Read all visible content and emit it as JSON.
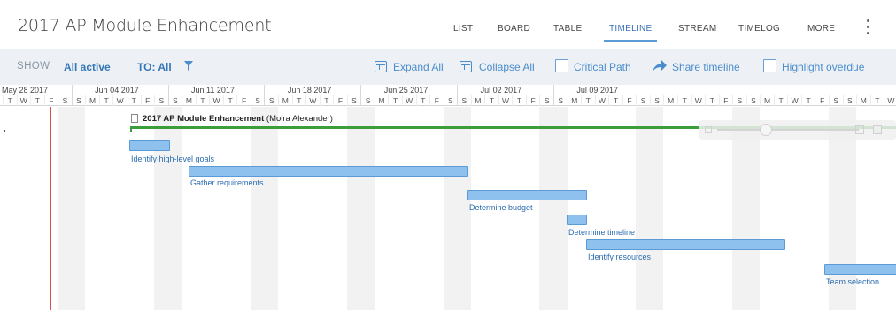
{
  "header": {
    "title": "2017 AP Module Enhancement",
    "nav": [
      "LIST",
      "BOARD",
      "TABLE",
      "TIMELINE",
      "STREAM",
      "TIMELOG",
      "MORE"
    ],
    "active_nav": "TIMELINE"
  },
  "toolbar": {
    "show_label": "SHOW",
    "show_value": "All active",
    "to_value": "TO: All",
    "expand_all": "Expand All",
    "collapse_all": "Collapse All",
    "critical_path": "Critical Path",
    "share_timeline": "Share timeline",
    "highlight_overdue": "Highlight overdue"
  },
  "timeline": {
    "weeks": [
      "May 28 2017",
      "Jun 04 2017",
      "Jun 11 2017",
      "Jun 18 2017",
      "Jun 25 2017",
      "Jul 02 2017",
      "Jul 09 2017"
    ],
    "days": [
      "T",
      "W",
      "T",
      "F",
      "S",
      "S",
      "M",
      "T",
      "W",
      "T",
      "F",
      "S",
      "S",
      "M",
      "T",
      "W",
      "T",
      "F",
      "S",
      "S",
      "M",
      "T",
      "W",
      "T",
      "F",
      "S",
      "S",
      "M",
      "T",
      "W",
      "T",
      "F",
      "S",
      "S",
      "M",
      "T",
      "W",
      "T",
      "F",
      "S",
      "S",
      "M",
      "T",
      "W",
      "T",
      "F",
      "S",
      "S",
      "M",
      "T",
      "W",
      "T",
      "F",
      "S",
      "S",
      "M",
      "T",
      "W",
      "T",
      "F",
      "S",
      "S",
      "M",
      "T",
      "W",
      "T"
    ],
    "project": {
      "name": "2017 AP Module Enhancement",
      "owner": "(Moira Alexander)"
    },
    "tasks": [
      {
        "label": "Identify high-level goals"
      },
      {
        "label": "Gather requirements"
      },
      {
        "label": "Determine budget"
      },
      {
        "label": "Determine timeline"
      },
      {
        "label": "Identify resources"
      },
      {
        "label": "Team selection"
      }
    ]
  },
  "colors": {
    "accent": "#3576b7",
    "bar_fill": "#8fc1ef",
    "summary_line": "#3a9e3a",
    "today_line": "#d9534f"
  }
}
